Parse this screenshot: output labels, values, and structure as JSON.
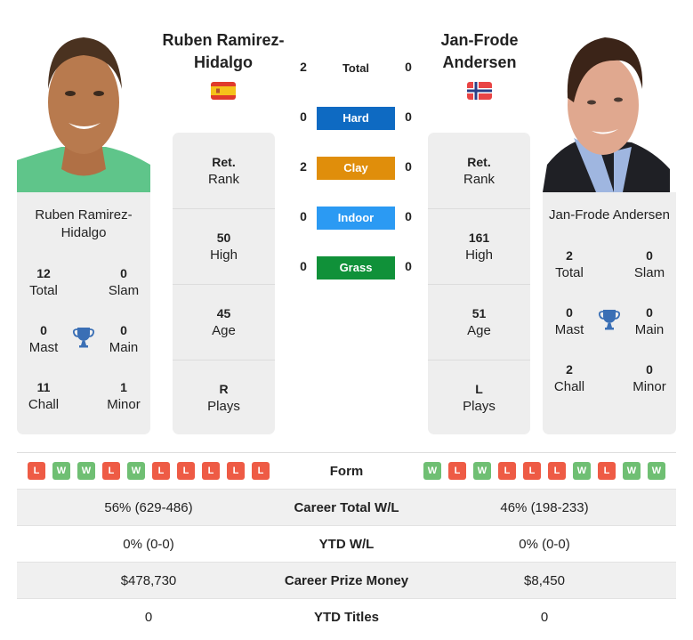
{
  "colors": {
    "hard": "#0e6ac2",
    "clay": "#e08e0b",
    "indoor": "#2b9af3",
    "grass": "#109139",
    "win": "#6fbf73",
    "loss": "#ee5b45",
    "trophy": "#3a6fb5",
    "card_bg": "#eeeeee"
  },
  "player1": {
    "name": "Ruben Ramirez-Hidalgo",
    "name_line1": "Ruben Ramirez-",
    "name_line2": "Hidalgo",
    "country_flag": "spain-flag",
    "photo": "player1-photo",
    "titles": {
      "total": {
        "value": "12",
        "label": "Total"
      },
      "slam": {
        "value": "0",
        "label": "Slam"
      },
      "mast": {
        "value": "0",
        "label": "Mast"
      },
      "main": {
        "value": "0",
        "label": "Main"
      },
      "chall": {
        "value": "11",
        "label": "Chall"
      },
      "minor": {
        "value": "1",
        "label": "Minor"
      }
    },
    "rank": {
      "value": "Ret.",
      "label": "Rank"
    },
    "high": {
      "value": "50",
      "label": "High"
    },
    "age": {
      "value": "45",
      "label": "Age"
    },
    "plays": {
      "value": "R",
      "label": "Plays"
    }
  },
  "player2": {
    "name": "Jan-Frode Andersen",
    "name_line1": "Jan-Frode",
    "name_line2": "Andersen",
    "country_flag": "norway-flag",
    "photo": "player2-photo",
    "titles": {
      "total": {
        "value": "2",
        "label": "Total"
      },
      "slam": {
        "value": "0",
        "label": "Slam"
      },
      "mast": {
        "value": "0",
        "label": "Mast"
      },
      "main": {
        "value": "0",
        "label": "Main"
      },
      "chall": {
        "value": "2",
        "label": "Chall"
      },
      "minor": {
        "value": "0",
        "label": "Minor"
      }
    },
    "rank": {
      "value": "Ret.",
      "label": "Rank"
    },
    "high": {
      "value": "161",
      "label": "High"
    },
    "age": {
      "value": "51",
      "label": "Age"
    },
    "plays": {
      "value": "L",
      "label": "Plays"
    }
  },
  "h2h": {
    "total": {
      "label": "Total",
      "p1": "2",
      "p2": "0"
    },
    "surfaces": [
      {
        "label": "Hard",
        "p1": "0",
        "p2": "0"
      },
      {
        "label": "Clay",
        "p1": "2",
        "p2": "0"
      },
      {
        "label": "Indoor",
        "p1": "0",
        "p2": "0"
      },
      {
        "label": "Grass",
        "p1": "0",
        "p2": "0"
      }
    ]
  },
  "comparison": {
    "form": {
      "label": "Form",
      "p1": [
        "L",
        "W",
        "W",
        "L",
        "W",
        "L",
        "L",
        "L",
        "L",
        "L"
      ],
      "p2": [
        "W",
        "L",
        "W",
        "L",
        "L",
        "L",
        "W",
        "L",
        "W",
        "W"
      ]
    },
    "rows": [
      {
        "label": "Career Total W/L",
        "p1": "56% (629-486)",
        "p2": "46% (198-233)"
      },
      {
        "label": "YTD W/L",
        "p1": "0% (0-0)",
        "p2": "0% (0-0)"
      },
      {
        "label": "Career Prize Money",
        "p1": "$478,730",
        "p2": "$8,450"
      },
      {
        "label": "YTD Titles",
        "p1": "0",
        "p2": "0"
      }
    ]
  }
}
